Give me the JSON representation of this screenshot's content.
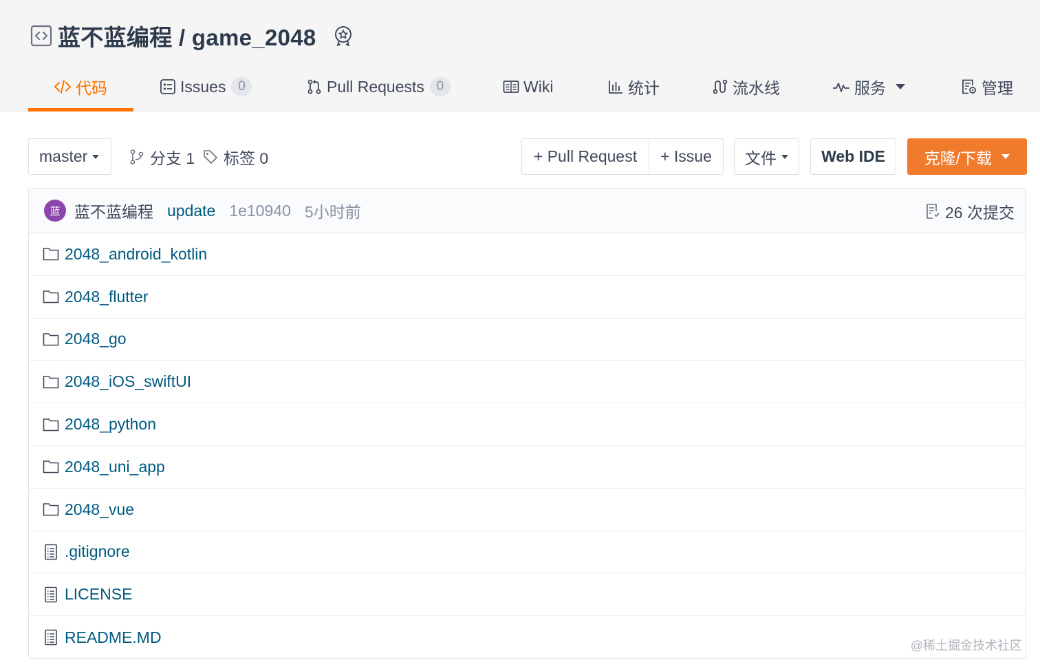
{
  "repo": {
    "owner": "蓝不蓝编程",
    "separator": " / ",
    "name": "game_2048"
  },
  "tabs": [
    {
      "label": "代码",
      "icon": "code-icon",
      "active": true
    },
    {
      "label": "Issues",
      "count": "0",
      "icon": "issues-icon"
    },
    {
      "label": "Pull Requests",
      "count": "0",
      "icon": "pull-request-icon"
    },
    {
      "label": "Wiki",
      "icon": "wiki-icon"
    },
    {
      "label": "统计",
      "icon": "stats-icon"
    },
    {
      "label": "流水线",
      "icon": "pipeline-icon"
    },
    {
      "label": "服务",
      "icon": "service-icon",
      "dropdown": true
    },
    {
      "label": "管理",
      "icon": "manage-icon"
    }
  ],
  "toolbar": {
    "branch_select": "master",
    "branches_label": "分支 1",
    "tags_label": "标签 0",
    "new_pr": "+ Pull Request",
    "new_issue": "+ Issue",
    "file_menu": "文件",
    "web_ide": "Web IDE",
    "clone": "克隆/下载"
  },
  "commit": {
    "avatar_text": "蓝",
    "author": "蓝不蓝编程",
    "message": "update",
    "sha": "1e10940",
    "time": "5小时前",
    "count_label": "26 次提交"
  },
  "files": [
    {
      "name": "2048_android_kotlin",
      "type": "folder"
    },
    {
      "name": "2048_flutter",
      "type": "folder"
    },
    {
      "name": "2048_go",
      "type": "folder"
    },
    {
      "name": "2048_iOS_swiftUI",
      "type": "folder"
    },
    {
      "name": "2048_python",
      "type": "folder"
    },
    {
      "name": "2048_uni_app",
      "type": "folder"
    },
    {
      "name": "2048_vue",
      "type": "folder"
    },
    {
      "name": ".gitignore",
      "type": "file"
    },
    {
      "name": "LICENSE",
      "type": "file"
    },
    {
      "name": "README.MD",
      "type": "file"
    }
  ],
  "watermark": "@稀土掘金技术社区",
  "colors": {
    "accent": "#fe7300",
    "clone_bg": "#f17b2c",
    "link": "#005980",
    "avatar": "#8e44ad"
  }
}
